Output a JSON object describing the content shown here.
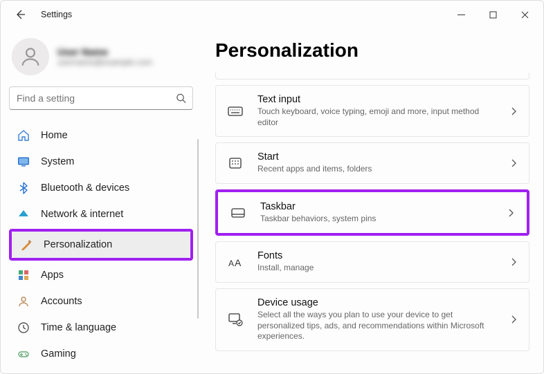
{
  "titlebar": {
    "title": "Settings"
  },
  "profile": {
    "name": "User Name",
    "email": "username@example.com"
  },
  "search": {
    "placeholder": "Find a setting"
  },
  "sidebar": {
    "items": [
      {
        "label": "Home"
      },
      {
        "label": "System"
      },
      {
        "label": "Bluetooth & devices"
      },
      {
        "label": "Network & internet"
      },
      {
        "label": "Personalization"
      },
      {
        "label": "Apps"
      },
      {
        "label": "Accounts"
      },
      {
        "label": "Time & language"
      },
      {
        "label": "Gaming"
      }
    ]
  },
  "main": {
    "heading": "Personalization",
    "cards": [
      {
        "title": "Text input",
        "subtitle": "Touch keyboard, voice typing, emoji and more, input method editor"
      },
      {
        "title": "Start",
        "subtitle": "Recent apps and items, folders"
      },
      {
        "title": "Taskbar",
        "subtitle": "Taskbar behaviors, system pins"
      },
      {
        "title": "Fonts",
        "subtitle": "Install, manage"
      },
      {
        "title": "Device usage",
        "subtitle": "Select all the ways you plan to use your device to get personalized tips, ads, and recommendations within Microsoft experiences."
      }
    ]
  }
}
